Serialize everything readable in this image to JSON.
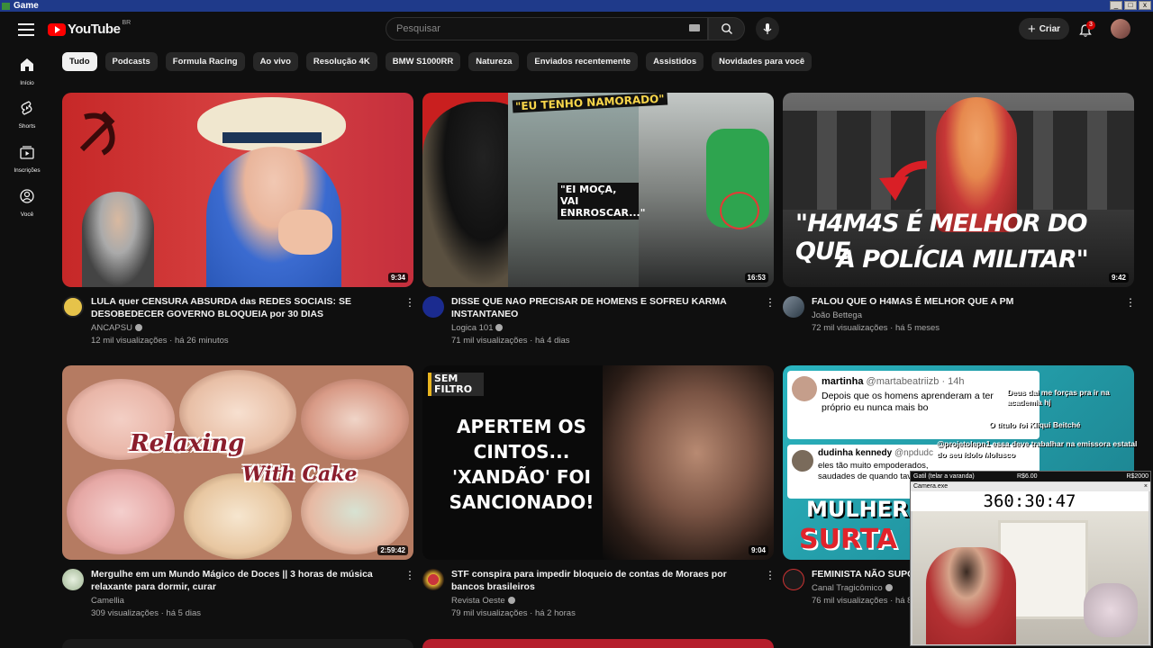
{
  "window": {
    "title": "Game"
  },
  "header": {
    "logo_text": "YouTube",
    "country_code": "BR",
    "search_placeholder": "Pesquisar",
    "create_label": "Criar",
    "notifications_count": "3"
  },
  "sidebar": {
    "items": [
      {
        "label": "Início",
        "icon": "home-icon"
      },
      {
        "label": "Shorts",
        "icon": "shorts-icon"
      },
      {
        "label": "Inscrições",
        "icon": "subscriptions-icon"
      },
      {
        "label": "Você",
        "icon": "user-icon"
      }
    ]
  },
  "chips": [
    "Tudo",
    "Podcasts",
    "Formula Racing",
    "Ao vivo",
    "Resolução 4K",
    "BMW S1000RR",
    "Natureza",
    "Enviados recentemente",
    "Assistidos",
    "Novidades para você"
  ],
  "videos": [
    {
      "title": "LULA quer CENSURA ABSURDA das REDES SOCIAIS: SE DESOBEDECER GOVERNO BLOQUEIA por 30 DIAS",
      "channel": "ANCAPSU",
      "views": "12 mil visualizações",
      "age": "há 26 minutos",
      "duration": "9:34"
    },
    {
      "title": "DISSE QUE NAO PRECISAR DE HOMENS E SOFREU KARMA INSTANTANEO",
      "channel": "Logica 101",
      "views": "71 mil visualizações",
      "age": "há 4 dias",
      "duration": "16:53",
      "thumb_text_1": "\"EU TENHO NAMORADO\"",
      "thumb_text_2": "\"EI MOÇA, VAI ENRROSCAR...\""
    },
    {
      "title": "FALOU QUE O H4MAS É MELHOR QUE A PM",
      "channel": "João Bettega",
      "views": "72 mil visualizações",
      "age": "há 5 meses",
      "duration": "9:42",
      "thumb_text_1": "\"H4M4S É MELHOR DO QUE",
      "thumb_text_2": "A POLÍCIA MILITAR\""
    },
    {
      "title": "Mergulhe em um Mundo Mágico de Doces || 3 horas de música relaxante para dormir, curar",
      "channel": "Camellia",
      "views": "309 visualizações",
      "age": "há 5 dias",
      "duration": "2:59:42",
      "thumb_text_1": "Relaxing",
      "thumb_text_2": "With Cake"
    },
    {
      "title": "STF conspira para impedir bloqueio de contas de Moraes por bancos brasileiros",
      "channel": "Revista Oeste",
      "views": "79 mil visualizações",
      "age": "há 2 horas",
      "duration": "9:04",
      "thumb_tag": "SEM FILTRO",
      "thumb_text_1": "APERTEM OS CINTOS... 'XANDÃO' FOI SANCIONADO!"
    },
    {
      "title": "FEMINISTA NÃO SUPO",
      "channel": "Canal Tragicômico",
      "views": "76 mil visualizações",
      "age": "há 8",
      "thumb_text_1": "MULHER",
      "thumb_text_2": "SURTA",
      "tweet_1_name": "martinha",
      "tweet_1_handle": "@martabeatriizb · 14h",
      "tweet_1_text": "Depois que os homens aprenderam a ter próprio eu nunca mais bo",
      "tweet_2_name": "dudinha kennedy",
      "tweet_2_handle": "@npdudc",
      "tweet_2_text": "eles tão muito empoderados, saudades de quando tava na moda"
    }
  ],
  "overlay": {
    "title": "Gatil (telar a varanda)",
    "goal_1": "R$6.00",
    "goal_2": "R$2000",
    "window_label": "Camera.exe",
    "timer": "360:30:47",
    "chat_1": "Deus dai me forças pra ir na academia hj",
    "chat_2": "O título foi Kliqui Beitché",
    "chat_3": "@projetolepn1 essa deve trabalhar na emissora estatal do seu ídolo Molusco"
  }
}
